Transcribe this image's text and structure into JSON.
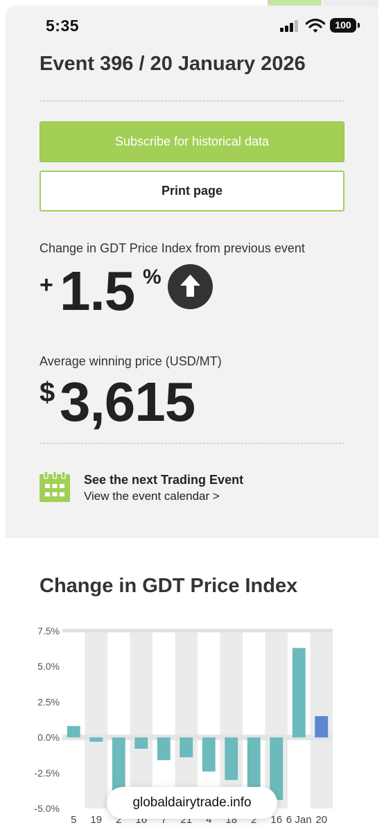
{
  "status_bar": {
    "time": "5:35",
    "battery": "100"
  },
  "event": {
    "title": "Event 396 / 20 January 2026"
  },
  "buttons": {
    "subscribe": "Subscribe for historical data",
    "print": "Print page"
  },
  "price_index_change": {
    "label": "Change in GDT Price Index from previous event",
    "sign": "+",
    "value": "1.5",
    "unit": "%",
    "direction_icon": "arrow-up-icon"
  },
  "average_price": {
    "label": "Average winning price (USD/MT)",
    "currency": "$",
    "value": "3,615"
  },
  "next_event": {
    "title": "See the next Trading Event",
    "link": "View the event calendar >",
    "icon": "calendar-icon"
  },
  "chart_section": {
    "title": "Change in GDT Price Index"
  },
  "chart_data": {
    "type": "bar",
    "title": "Change in GDT Price Index",
    "categories": [
      "5",
      "19",
      "2",
      "16",
      "7",
      "21",
      "4",
      "18",
      "2",
      "16",
      "6 Jan",
      "20"
    ],
    "values": [
      0.8,
      -0.3,
      -4.3,
      -0.8,
      -1.6,
      -1.4,
      -2.4,
      -3.0,
      -4.4,
      -4.4,
      6.3,
      1.5
    ],
    "ylim": [
      -5.0,
      7.5
    ],
    "yticks": [
      "7.5%",
      "5.0%",
      "2.5%",
      "0.0%",
      "-2.5%",
      "-5.0%"
    ],
    "grid": true,
    "colors": {
      "bar": "#6cbabb",
      "latest": "#5b87cf",
      "band": "#ebebeb"
    }
  },
  "colors": {
    "accent_green": "#a2cf56",
    "card_bg": "#f2f2f2",
    "text": "#333333"
  },
  "url_bar": {
    "text": "globaldairytrade.info"
  }
}
